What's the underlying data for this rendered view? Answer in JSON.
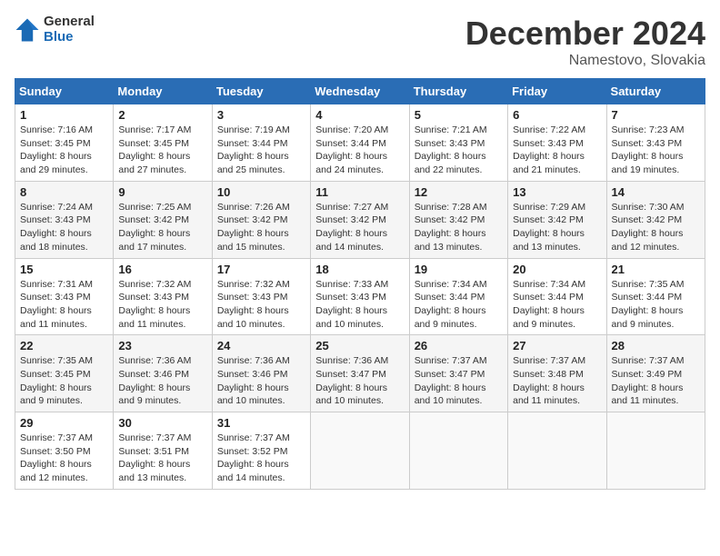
{
  "header": {
    "logo_general": "General",
    "logo_blue": "Blue",
    "month_title": "December 2024",
    "location": "Namestovo, Slovakia"
  },
  "weekdays": [
    "Sunday",
    "Monday",
    "Tuesday",
    "Wednesday",
    "Thursday",
    "Friday",
    "Saturday"
  ],
  "weeks": [
    [
      {
        "day": "1",
        "info": "Sunrise: 7:16 AM\nSunset: 3:45 PM\nDaylight: 8 hours\nand 29 minutes."
      },
      {
        "day": "2",
        "info": "Sunrise: 7:17 AM\nSunset: 3:45 PM\nDaylight: 8 hours\nand 27 minutes."
      },
      {
        "day": "3",
        "info": "Sunrise: 7:19 AM\nSunset: 3:44 PM\nDaylight: 8 hours\nand 25 minutes."
      },
      {
        "day": "4",
        "info": "Sunrise: 7:20 AM\nSunset: 3:44 PM\nDaylight: 8 hours\nand 24 minutes."
      },
      {
        "day": "5",
        "info": "Sunrise: 7:21 AM\nSunset: 3:43 PM\nDaylight: 8 hours\nand 22 minutes."
      },
      {
        "day": "6",
        "info": "Sunrise: 7:22 AM\nSunset: 3:43 PM\nDaylight: 8 hours\nand 21 minutes."
      },
      {
        "day": "7",
        "info": "Sunrise: 7:23 AM\nSunset: 3:43 PM\nDaylight: 8 hours\nand 19 minutes."
      }
    ],
    [
      {
        "day": "8",
        "info": "Sunrise: 7:24 AM\nSunset: 3:43 PM\nDaylight: 8 hours\nand 18 minutes."
      },
      {
        "day": "9",
        "info": "Sunrise: 7:25 AM\nSunset: 3:42 PM\nDaylight: 8 hours\nand 17 minutes."
      },
      {
        "day": "10",
        "info": "Sunrise: 7:26 AM\nSunset: 3:42 PM\nDaylight: 8 hours\nand 15 minutes."
      },
      {
        "day": "11",
        "info": "Sunrise: 7:27 AM\nSunset: 3:42 PM\nDaylight: 8 hours\nand 14 minutes."
      },
      {
        "day": "12",
        "info": "Sunrise: 7:28 AM\nSunset: 3:42 PM\nDaylight: 8 hours\nand 13 minutes."
      },
      {
        "day": "13",
        "info": "Sunrise: 7:29 AM\nSunset: 3:42 PM\nDaylight: 8 hours\nand 13 minutes."
      },
      {
        "day": "14",
        "info": "Sunrise: 7:30 AM\nSunset: 3:42 PM\nDaylight: 8 hours\nand 12 minutes."
      }
    ],
    [
      {
        "day": "15",
        "info": "Sunrise: 7:31 AM\nSunset: 3:43 PM\nDaylight: 8 hours\nand 11 minutes."
      },
      {
        "day": "16",
        "info": "Sunrise: 7:32 AM\nSunset: 3:43 PM\nDaylight: 8 hours\nand 11 minutes."
      },
      {
        "day": "17",
        "info": "Sunrise: 7:32 AM\nSunset: 3:43 PM\nDaylight: 8 hours\nand 10 minutes."
      },
      {
        "day": "18",
        "info": "Sunrise: 7:33 AM\nSunset: 3:43 PM\nDaylight: 8 hours\nand 10 minutes."
      },
      {
        "day": "19",
        "info": "Sunrise: 7:34 AM\nSunset: 3:44 PM\nDaylight: 8 hours\nand 9 minutes."
      },
      {
        "day": "20",
        "info": "Sunrise: 7:34 AM\nSunset: 3:44 PM\nDaylight: 8 hours\nand 9 minutes."
      },
      {
        "day": "21",
        "info": "Sunrise: 7:35 AM\nSunset: 3:44 PM\nDaylight: 8 hours\nand 9 minutes."
      }
    ],
    [
      {
        "day": "22",
        "info": "Sunrise: 7:35 AM\nSunset: 3:45 PM\nDaylight: 8 hours\nand 9 minutes."
      },
      {
        "day": "23",
        "info": "Sunrise: 7:36 AM\nSunset: 3:46 PM\nDaylight: 8 hours\nand 9 minutes."
      },
      {
        "day": "24",
        "info": "Sunrise: 7:36 AM\nSunset: 3:46 PM\nDaylight: 8 hours\nand 10 minutes."
      },
      {
        "day": "25",
        "info": "Sunrise: 7:36 AM\nSunset: 3:47 PM\nDaylight: 8 hours\nand 10 minutes."
      },
      {
        "day": "26",
        "info": "Sunrise: 7:37 AM\nSunset: 3:47 PM\nDaylight: 8 hours\nand 10 minutes."
      },
      {
        "day": "27",
        "info": "Sunrise: 7:37 AM\nSunset: 3:48 PM\nDaylight: 8 hours\nand 11 minutes."
      },
      {
        "day": "28",
        "info": "Sunrise: 7:37 AM\nSunset: 3:49 PM\nDaylight: 8 hours\nand 11 minutes."
      }
    ],
    [
      {
        "day": "29",
        "info": "Sunrise: 7:37 AM\nSunset: 3:50 PM\nDaylight: 8 hours\nand 12 minutes."
      },
      {
        "day": "30",
        "info": "Sunrise: 7:37 AM\nSunset: 3:51 PM\nDaylight: 8 hours\nand 13 minutes."
      },
      {
        "day": "31",
        "info": "Sunrise: 7:37 AM\nSunset: 3:52 PM\nDaylight: 8 hours\nand 14 minutes."
      },
      {
        "day": "",
        "info": ""
      },
      {
        "day": "",
        "info": ""
      },
      {
        "day": "",
        "info": ""
      },
      {
        "day": "",
        "info": ""
      }
    ]
  ]
}
